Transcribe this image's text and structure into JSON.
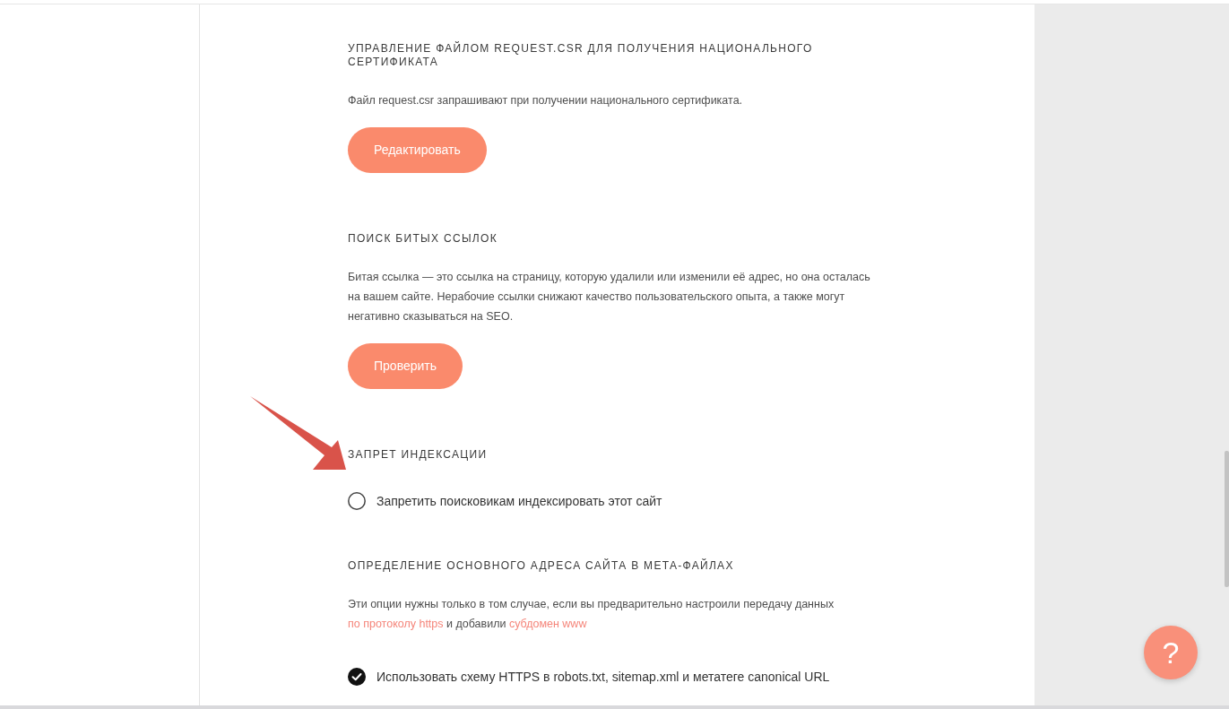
{
  "sections": [
    {
      "kind": "action",
      "title": "УПРАВЛЕНИЕ ФАЙЛОМ REQUEST.CSR ДЛЯ ПОЛУЧЕНИЯ НАЦИОНАЛЬНОГО СЕРТИФИКАТА",
      "description": "Файл request.csr запрашивают при получении национального сертификата.",
      "button": "Редактировать"
    },
    {
      "kind": "action",
      "title": "ПОИСК БИТЫХ ССЫЛОК",
      "description": "Битая ссылка — это ссылка на страницу, которую удалили или изменили её адрес, но она осталась на вашем сайте. Нерабочие ссылки снижают качество пользовательского опыта, а также могут негативно сказываться на SEO.",
      "button": "Проверить"
    },
    {
      "kind": "options",
      "title": "ЗАПРЕТ ИНДЕКСАЦИИ",
      "options": [
        {
          "label": "Запретить поисковикам индексировать этот сайт",
          "checked": false
        }
      ]
    },
    {
      "kind": "options",
      "title": "ОПРЕДЕЛЕНИЕ ОСНОВНОГО АДРЕСА САЙТА В МЕТА-ФАЙЛАХ",
      "description": [
        {
          "kind": "text",
          "text": "Эти опции нужны только в том случае, если вы предварительно настроили передачу данных"
        },
        {
          "kind": "link",
          "text": "по протоколу https"
        },
        {
          "kind": "text",
          "text": "и добавили"
        },
        {
          "kind": "link",
          "text": "субдомен www"
        }
      ],
      "options": [
        {
          "label": "Использовать схему HTTPS в robots.txt, sitemap.xml и метатеге canonical URL",
          "checked": true
        }
      ]
    }
  ],
  "help_button": {
    "label": "?"
  }
}
